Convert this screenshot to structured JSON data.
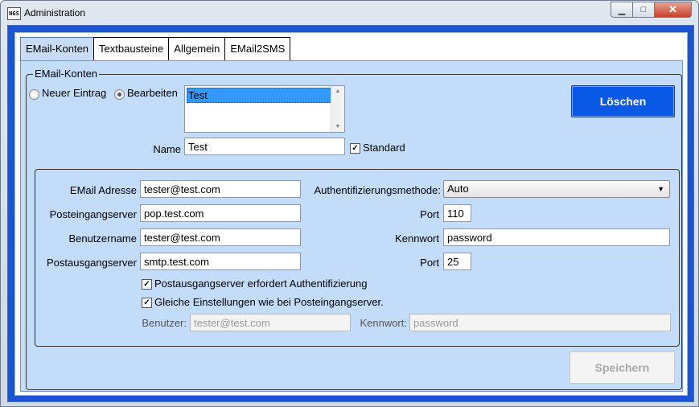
{
  "window": {
    "title": "Administration",
    "app_icon_text": "NGS"
  },
  "tabs": [
    "EMail-Konten",
    "Textbausteine",
    "Allgemein",
    "EMail2SMS"
  ],
  "group": {
    "legend": "EMail-Konten",
    "radio_new": "Neuer Eintrag",
    "radio_edit": "Bearbeiten",
    "list_items": [
      "Test"
    ],
    "name_label": "Name",
    "name_value": "Test",
    "standard_label": "Standard",
    "delete_label": "Löschen",
    "save_label": "Speichern"
  },
  "account": {
    "email_label": "EMail Adresse",
    "email_value": "tester@test.com",
    "incoming_label": "Posteingangserver",
    "incoming_value": "pop.test.com",
    "username_label": "Benutzername",
    "username_value": "tester@test.com",
    "outgoing_label": "Postausgangserver",
    "outgoing_value": "smtp.test.com",
    "auth_label": "Authentifizierungsmethode:",
    "auth_value": "Auto",
    "port_label": "Port",
    "port_in_value": "110",
    "password_label": "Kennwort",
    "password_value": "password",
    "port_out_value": "25",
    "smtp_auth_label": "Postausgangserver erfordert Authentifizierung",
    "same_settings_label": "Gleiche Einstellungen wie bei Posteingangserver.",
    "user_label": "Benutzer:",
    "user_value": "tester@test.com",
    "user_password_label": "Kennwort:",
    "user_password_value": "password"
  }
}
